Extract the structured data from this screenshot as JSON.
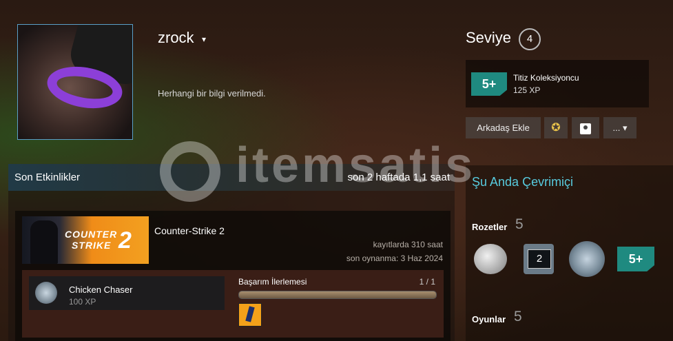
{
  "profile": {
    "username": "zrock",
    "username_caret": "▾",
    "bio": "Herhangi bir bilgi verilmedi."
  },
  "level": {
    "title": "Seviye",
    "value": "4",
    "badge_icon_text": "5+",
    "badge_name": "Titiz Koleksiyoncu",
    "badge_xp": "125 XP"
  },
  "actions": {
    "add_friend": "Arkadaş Ekle",
    "more": "... ▾"
  },
  "activity": {
    "title": "Son Etkinlikler",
    "hours": "son 2 haftada 1,1 saat",
    "game": {
      "name": "Counter-Strike 2",
      "banner_line1": "COUNTER",
      "banner_line2": "STRIKE",
      "banner_num": "2",
      "hours_on_record": "kayıtlarda 310 saat",
      "last_played": "son oynanma: 3 Haz 2024",
      "achievement": {
        "name": "Chicken Chaser",
        "xp": "100 XP",
        "progress_label": "Başarım İlerlemesi",
        "progress_count": "1 / 1",
        "progress_fraction": 1.0
      }
    }
  },
  "sidebar": {
    "online_status": "Şu Anda Çevrimiçi",
    "badges_label": "Rozetler",
    "badges_count": "5",
    "badge2_value": "2",
    "badge4_text": "5+",
    "games_label": "Oyunlar",
    "games_count": "5"
  },
  "watermark": {
    "text": "itemsatis"
  },
  "colors": {
    "online": "#57cbde",
    "badge_teal": "#1f8a80",
    "cs_orange": "#f08c18"
  }
}
